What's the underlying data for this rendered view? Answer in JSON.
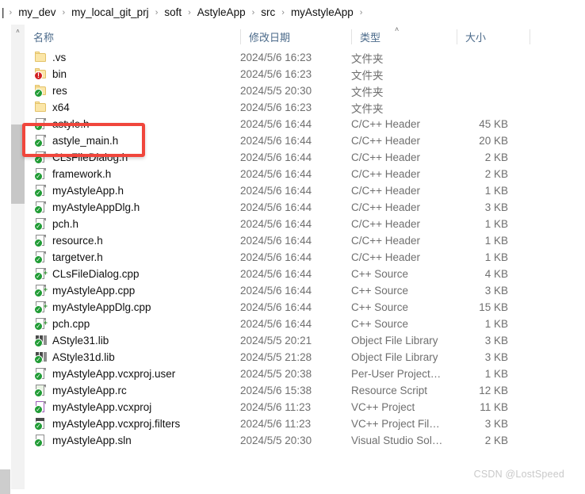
{
  "breadcrumb": {
    "leading_stub": "|",
    "items": [
      "my_dev",
      "my_local_git_prj",
      "soft",
      "AstyleApp",
      "src",
      "myAstyleApp"
    ],
    "separator": "›"
  },
  "columns": {
    "name": "名称",
    "date": "修改日期",
    "type": "类型",
    "size": "大小",
    "sort_caret": "˄",
    "sort_column": "类型",
    "sort_direction": "ascending"
  },
  "scrollbar": {
    "up_arrow": "˄"
  },
  "files": [
    {
      "name": ".vs",
      "date": "2024/5/6 16:23",
      "type": "文件夹",
      "size": "",
      "icon": "folder-icon",
      "badge": "none"
    },
    {
      "name": "bin",
      "date": "2024/5/6 16:23",
      "type": "文件夹",
      "size": "",
      "icon": "folder-icon",
      "badge": "error"
    },
    {
      "name": "res",
      "date": "2024/5/5 20:30",
      "type": "文件夹",
      "size": "",
      "icon": "folder-icon",
      "badge": "ok"
    },
    {
      "name": "x64",
      "date": "2024/5/6 16:23",
      "type": "文件夹",
      "size": "",
      "icon": "folder-icon",
      "badge": "none"
    },
    {
      "name": "astyle.h",
      "date": "2024/5/6 16:44",
      "type": "C/C++ Header",
      "size": "45 KB",
      "icon": "header-file-icon",
      "badge": "ok"
    },
    {
      "name": "astyle_main.h",
      "date": "2024/5/6 16:44",
      "type": "C/C++ Header",
      "size": "20 KB",
      "icon": "header-file-icon",
      "badge": "ok"
    },
    {
      "name": "CLsFileDialog.h",
      "date": "2024/5/6 16:44",
      "type": "C/C++ Header",
      "size": "2 KB",
      "icon": "header-file-icon",
      "badge": "ok"
    },
    {
      "name": "framework.h",
      "date": "2024/5/6 16:44",
      "type": "C/C++ Header",
      "size": "2 KB",
      "icon": "header-file-icon",
      "badge": "ok"
    },
    {
      "name": "myAstyleApp.h",
      "date": "2024/5/6 16:44",
      "type": "C/C++ Header",
      "size": "1 KB",
      "icon": "header-file-icon",
      "badge": "ok"
    },
    {
      "name": "myAstyleAppDlg.h",
      "date": "2024/5/6 16:44",
      "type": "C/C++ Header",
      "size": "3 KB",
      "icon": "header-file-icon",
      "badge": "ok"
    },
    {
      "name": "pch.h",
      "date": "2024/5/6 16:44",
      "type": "C/C++ Header",
      "size": "1 KB",
      "icon": "header-file-icon",
      "badge": "ok"
    },
    {
      "name": "resource.h",
      "date": "2024/5/6 16:44",
      "type": "C/C++ Header",
      "size": "1 KB",
      "icon": "header-file-icon",
      "badge": "ok"
    },
    {
      "name": "targetver.h",
      "date": "2024/5/6 16:44",
      "type": "C/C++ Header",
      "size": "1 KB",
      "icon": "header-file-icon",
      "badge": "ok"
    },
    {
      "name": "CLsFileDialog.cpp",
      "date": "2024/5/6 16:44",
      "type": "C++ Source",
      "size": "4 KB",
      "icon": "cpp-source-icon",
      "badge": "ok"
    },
    {
      "name": "myAstyleApp.cpp",
      "date": "2024/5/6 16:44",
      "type": "C++ Source",
      "size": "3 KB",
      "icon": "cpp-source-icon",
      "badge": "ok"
    },
    {
      "name": "myAstyleAppDlg.cpp",
      "date": "2024/5/6 16:44",
      "type": "C++ Source",
      "size": "15 KB",
      "icon": "cpp-source-icon",
      "badge": "ok"
    },
    {
      "name": "pch.cpp",
      "date": "2024/5/6 16:44",
      "type": "C++ Source",
      "size": "1 KB",
      "icon": "cpp-source-icon",
      "badge": "ok"
    },
    {
      "name": "AStyle31.lib",
      "date": "2024/5/5 20:21",
      "type": "Object File Library",
      "size": "3 KB",
      "icon": "library-file-icon",
      "badge": "ok"
    },
    {
      "name": "AStyle31d.lib",
      "date": "2024/5/5 21:28",
      "type": "Object File Library",
      "size": "3 KB",
      "icon": "library-file-icon",
      "badge": "ok"
    },
    {
      "name": "myAstyleApp.vcxproj.user",
      "date": "2024/5/5 20:38",
      "type": "Per-User Project…",
      "size": "1 KB",
      "icon": "user-project-file-icon",
      "badge": "ok"
    },
    {
      "name": "myAstyleApp.rc",
      "date": "2024/5/6 15:38",
      "type": "Resource Script",
      "size": "12 KB",
      "icon": "resource-script-icon",
      "badge": "ok"
    },
    {
      "name": "myAstyleApp.vcxproj",
      "date": "2024/5/6 11:23",
      "type": "VC++ Project",
      "size": "11 KB",
      "icon": "vcxproj-file-icon",
      "badge": "ok"
    },
    {
      "name": "myAstyleApp.vcxproj.filters",
      "date": "2024/5/6 11:23",
      "type": "VC++ Project Fil…",
      "size": "3 KB",
      "icon": "vcxproj-filters-icon",
      "badge": "ok"
    },
    {
      "name": "myAstyleApp.sln",
      "date": "2024/5/5 20:30",
      "type": "Visual Studio Sol…",
      "size": "2 KB",
      "icon": "solution-file-icon",
      "badge": "ok"
    }
  ],
  "annotation": {
    "highlight_color": "#f0463c",
    "highlighted_files": [
      "astyle.h",
      "astyle_main.h"
    ]
  },
  "watermark": {
    "text": "CSDN @LostSpeed"
  }
}
